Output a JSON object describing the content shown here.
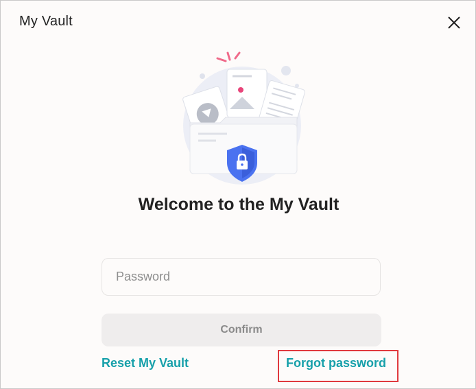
{
  "window": {
    "title": "My Vault"
  },
  "icons": {
    "close": "close-icon",
    "illustration": "vault-folder-shield-lock-illustration"
  },
  "main": {
    "heading": "Welcome to the My Vault",
    "password": {
      "value": "",
      "placeholder": "Password"
    },
    "confirm_label": "Confirm",
    "reset_label": "Reset My Vault",
    "forgot_label": "Forgot password"
  },
  "colors": {
    "link": "#17a0aa",
    "shield": "#4a72f0",
    "highlight_border": "#e0393e",
    "confirm_bg": "#efeded"
  }
}
